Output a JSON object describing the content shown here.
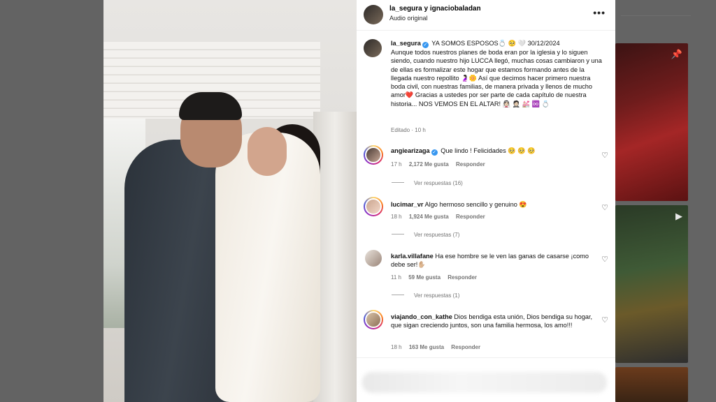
{
  "header": {
    "username": "la_segura y ignaciobaladan",
    "audio": "Audio original",
    "more": "•••"
  },
  "caption": {
    "username": "la_segura",
    "title": "YA SOMOS ESPOSOS💍 🥺 🤍 30/12/2024",
    "body": "Aunque todos nuestros planes de boda eran por la iglesia y lo siguen siendo, cuando nuestro hijo LUCCA llegó, muchas cosas cambiaron y una de ellas es formalizar este hogar que estamos formando antes de la llegada nuestro repollito 🤰🏻🌼 Así que decimos hacer primero nuestra boda civil, con nuestras familias, de manera privada y llenos de mucho amor❤️  Gracias a ustedes por ser parte de cada capítulo de nuestra historia... NOS VEMOS EN EL ALTAR! 👰🏻 🤵🏻 💒 ♾️ 💍",
    "edited": "Editado · 10 h"
  },
  "comments": [
    {
      "username": "angiearizaga",
      "verified": true,
      "text": "Que lindo ! Felicidades 🥺 🥺 🥺",
      "time": "17 h",
      "likes": "2,172 Me gusta",
      "reply": "Responder",
      "replies": "Ver respuestas (16)"
    },
    {
      "username": "lucimar_vr",
      "verified": false,
      "text": "Algo hermoso sencillo y genuino 😍",
      "time": "18 h",
      "likes": "1,924 Me gusta",
      "reply": "Responder",
      "replies": "Ver respuestas (7)"
    },
    {
      "username": "karla.villafane",
      "verified": false,
      "text": "Ha ese hombre se le ven las ganas de casarse ¡como debe ser!✋🏼",
      "time": "11 h",
      "likes": "59 Me gusta",
      "reply": "Responder",
      "replies": "Ver respuestas (1)"
    },
    {
      "username": "viajando_con_kathe",
      "verified": false,
      "text": "Dios bendiga esta unión, Dios bendiga su hogar, que sigan creciendo juntos, son una familia hermosa, los amo!!!",
      "time": "18 h",
      "likes": "163 Me gusta",
      "reply": "Responder",
      "replies": ""
    }
  ],
  "icons": {
    "heart": "♡",
    "pin": "📌",
    "reel": "▶"
  },
  "colors": {
    "verified": "#3797f0",
    "muted": "#737373"
  }
}
